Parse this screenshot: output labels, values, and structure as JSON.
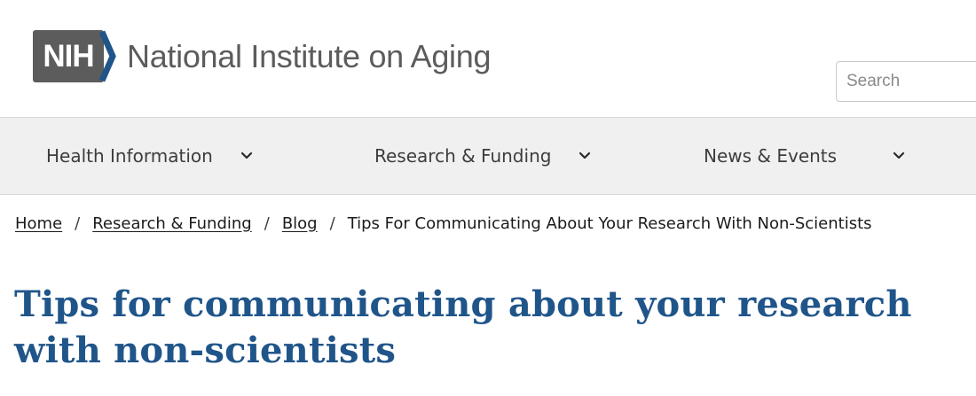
{
  "header": {
    "logo_badge": "NIH",
    "org_name": "National Institute on Aging",
    "search": {
      "placeholder": "Search",
      "value": ""
    },
    "colors": {
      "badge_gray": "#5c5c5c",
      "badge_chevron_blue": "#20558a"
    }
  },
  "nav": {
    "items": [
      {
        "label": "Health Information",
        "icon": "chevron-down-icon"
      },
      {
        "label": "Research & Funding",
        "icon": "chevron-down-icon"
      },
      {
        "label": "News & Events",
        "icon": "chevron-down-icon"
      }
    ]
  },
  "breadcrumb": {
    "links": [
      "Home",
      "Research & Funding",
      "Blog"
    ],
    "separator": "/",
    "current": "Tips For Communicating About Your Research With Non-Scientists"
  },
  "page": {
    "title": "Tips for communicating about your research with non-scientists",
    "title_color": "#20558a"
  }
}
